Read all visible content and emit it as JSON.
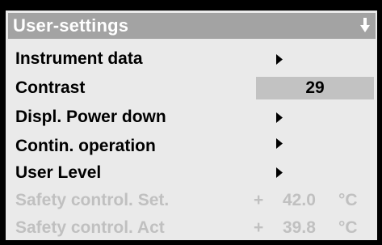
{
  "title": "User-settings",
  "menu": {
    "instrument_data": "Instrument data",
    "contrast": "Contrast",
    "contrast_value": "29",
    "displ_power_down": "Displ. Power down",
    "contin_operation": "Contin. operation",
    "user_level": "User Level"
  },
  "safety": {
    "set_label": "Safety control. Set.",
    "set_sign": "+",
    "set_value": "42.0",
    "set_unit": "°C",
    "act_label": "Safety control. Act",
    "act_sign": "+",
    "act_value": "39.8",
    "act_unit": "°C"
  },
  "colors": {
    "title_bar": "#a3a3a3",
    "background": "#eaeaea",
    "highlight": "#c2c2c2",
    "disabled_text": "#c0c0c0"
  },
  "icons": [
    "scroll-down-arrow-icon",
    "submenu-arrow-icon"
  ]
}
